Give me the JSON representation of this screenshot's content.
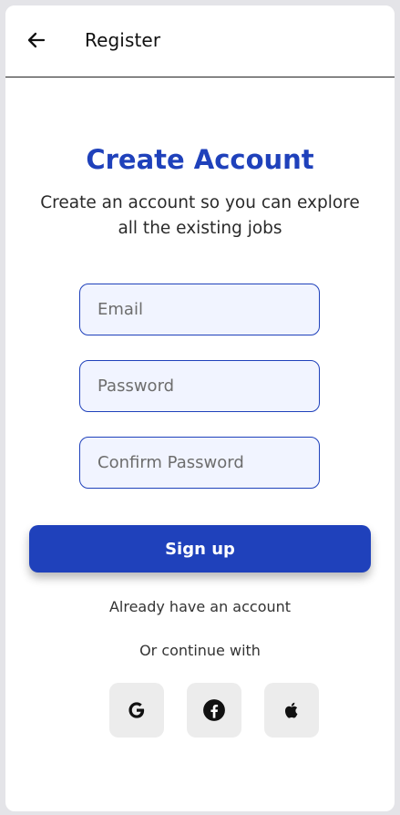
{
  "appbar": {
    "back_icon": "arrow-left-icon",
    "title": "Register"
  },
  "main": {
    "heading": "Create Account",
    "subheading": "Create an account so you can explore all the existing jobs",
    "fields": {
      "email": {
        "placeholder": "Email",
        "value": ""
      },
      "password": {
        "placeholder": "Password",
        "value": ""
      },
      "confirm_password": {
        "placeholder": "Confirm Password",
        "value": ""
      }
    },
    "signup_label": "Sign up",
    "login_link": "Already have an account",
    "continue_with": "Or continue with",
    "social": [
      {
        "name": "google",
        "icon": "google-icon"
      },
      {
        "name": "facebook",
        "icon": "facebook-icon"
      },
      {
        "name": "apple",
        "icon": "apple-icon"
      }
    ]
  },
  "colors": {
    "primary": "#1f41bb",
    "field_background": "#f1f4ff",
    "social_background": "#ececec",
    "page_background": "#e4e4e8"
  }
}
